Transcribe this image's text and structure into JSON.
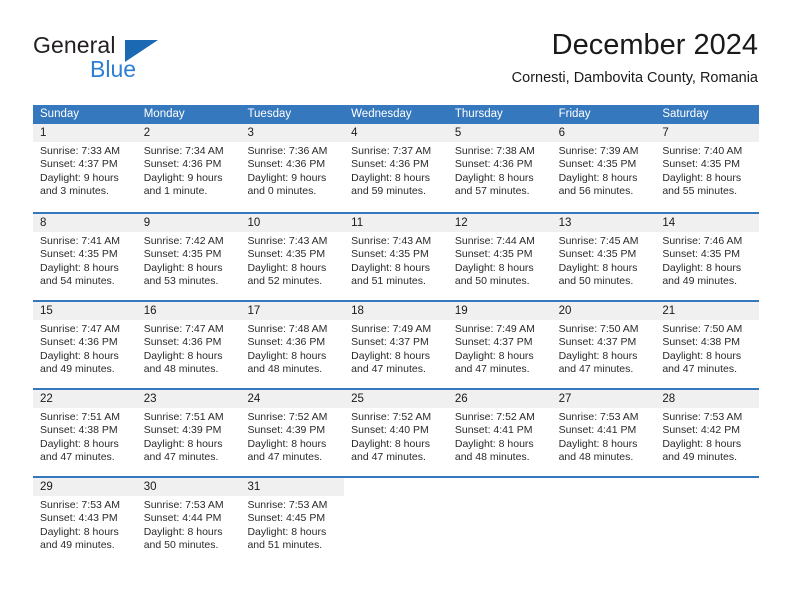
{
  "brand": {
    "name_part1": "General",
    "name_part2": "Blue",
    "triangle_color": "#1b69b3",
    "blue_color": "#2b7fd4"
  },
  "header": {
    "title": "December 2024",
    "subtitle": "Cornesti, Dambovita County, Romania"
  },
  "theme": {
    "header_blue": "#3678bd",
    "daynum_gray": "#f0f0f0",
    "text_color": "#1a1a1a"
  },
  "weekdays": [
    "Sunday",
    "Monday",
    "Tuesday",
    "Wednesday",
    "Thursday",
    "Friday",
    "Saturday"
  ],
  "weeks": [
    [
      {
        "day": "1",
        "sunrise": "Sunrise: 7:33 AM",
        "sunset": "Sunset: 4:37 PM",
        "daylight_l1": "Daylight: 9 hours",
        "daylight_l2": "and 3 minutes."
      },
      {
        "day": "2",
        "sunrise": "Sunrise: 7:34 AM",
        "sunset": "Sunset: 4:36 PM",
        "daylight_l1": "Daylight: 9 hours",
        "daylight_l2": "and 1 minute."
      },
      {
        "day": "3",
        "sunrise": "Sunrise: 7:36 AM",
        "sunset": "Sunset: 4:36 PM",
        "daylight_l1": "Daylight: 9 hours",
        "daylight_l2": "and 0 minutes."
      },
      {
        "day": "4",
        "sunrise": "Sunrise: 7:37 AM",
        "sunset": "Sunset: 4:36 PM",
        "daylight_l1": "Daylight: 8 hours",
        "daylight_l2": "and 59 minutes."
      },
      {
        "day": "5",
        "sunrise": "Sunrise: 7:38 AM",
        "sunset": "Sunset: 4:36 PM",
        "daylight_l1": "Daylight: 8 hours",
        "daylight_l2": "and 57 minutes."
      },
      {
        "day": "6",
        "sunrise": "Sunrise: 7:39 AM",
        "sunset": "Sunset: 4:35 PM",
        "daylight_l1": "Daylight: 8 hours",
        "daylight_l2": "and 56 minutes."
      },
      {
        "day": "7",
        "sunrise": "Sunrise: 7:40 AM",
        "sunset": "Sunset: 4:35 PM",
        "daylight_l1": "Daylight: 8 hours",
        "daylight_l2": "and 55 minutes."
      }
    ],
    [
      {
        "day": "8",
        "sunrise": "Sunrise: 7:41 AM",
        "sunset": "Sunset: 4:35 PM",
        "daylight_l1": "Daylight: 8 hours",
        "daylight_l2": "and 54 minutes."
      },
      {
        "day": "9",
        "sunrise": "Sunrise: 7:42 AM",
        "sunset": "Sunset: 4:35 PM",
        "daylight_l1": "Daylight: 8 hours",
        "daylight_l2": "and 53 minutes."
      },
      {
        "day": "10",
        "sunrise": "Sunrise: 7:43 AM",
        "sunset": "Sunset: 4:35 PM",
        "daylight_l1": "Daylight: 8 hours",
        "daylight_l2": "and 52 minutes."
      },
      {
        "day": "11",
        "sunrise": "Sunrise: 7:43 AM",
        "sunset": "Sunset: 4:35 PM",
        "daylight_l1": "Daylight: 8 hours",
        "daylight_l2": "and 51 minutes."
      },
      {
        "day": "12",
        "sunrise": "Sunrise: 7:44 AM",
        "sunset": "Sunset: 4:35 PM",
        "daylight_l1": "Daylight: 8 hours",
        "daylight_l2": "and 50 minutes."
      },
      {
        "day": "13",
        "sunrise": "Sunrise: 7:45 AM",
        "sunset": "Sunset: 4:35 PM",
        "daylight_l1": "Daylight: 8 hours",
        "daylight_l2": "and 50 minutes."
      },
      {
        "day": "14",
        "sunrise": "Sunrise: 7:46 AM",
        "sunset": "Sunset: 4:35 PM",
        "daylight_l1": "Daylight: 8 hours",
        "daylight_l2": "and 49 minutes."
      }
    ],
    [
      {
        "day": "15",
        "sunrise": "Sunrise: 7:47 AM",
        "sunset": "Sunset: 4:36 PM",
        "daylight_l1": "Daylight: 8 hours",
        "daylight_l2": "and 49 minutes."
      },
      {
        "day": "16",
        "sunrise": "Sunrise: 7:47 AM",
        "sunset": "Sunset: 4:36 PM",
        "daylight_l1": "Daylight: 8 hours",
        "daylight_l2": "and 48 minutes."
      },
      {
        "day": "17",
        "sunrise": "Sunrise: 7:48 AM",
        "sunset": "Sunset: 4:36 PM",
        "daylight_l1": "Daylight: 8 hours",
        "daylight_l2": "and 48 minutes."
      },
      {
        "day": "18",
        "sunrise": "Sunrise: 7:49 AM",
        "sunset": "Sunset: 4:37 PM",
        "daylight_l1": "Daylight: 8 hours",
        "daylight_l2": "and 47 minutes."
      },
      {
        "day": "19",
        "sunrise": "Sunrise: 7:49 AM",
        "sunset": "Sunset: 4:37 PM",
        "daylight_l1": "Daylight: 8 hours",
        "daylight_l2": "and 47 minutes."
      },
      {
        "day": "20",
        "sunrise": "Sunrise: 7:50 AM",
        "sunset": "Sunset: 4:37 PM",
        "daylight_l1": "Daylight: 8 hours",
        "daylight_l2": "and 47 minutes."
      },
      {
        "day": "21",
        "sunrise": "Sunrise: 7:50 AM",
        "sunset": "Sunset: 4:38 PM",
        "daylight_l1": "Daylight: 8 hours",
        "daylight_l2": "and 47 minutes."
      }
    ],
    [
      {
        "day": "22",
        "sunrise": "Sunrise: 7:51 AM",
        "sunset": "Sunset: 4:38 PM",
        "daylight_l1": "Daylight: 8 hours",
        "daylight_l2": "and 47 minutes."
      },
      {
        "day": "23",
        "sunrise": "Sunrise: 7:51 AM",
        "sunset": "Sunset: 4:39 PM",
        "daylight_l1": "Daylight: 8 hours",
        "daylight_l2": "and 47 minutes."
      },
      {
        "day": "24",
        "sunrise": "Sunrise: 7:52 AM",
        "sunset": "Sunset: 4:39 PM",
        "daylight_l1": "Daylight: 8 hours",
        "daylight_l2": "and 47 minutes."
      },
      {
        "day": "25",
        "sunrise": "Sunrise: 7:52 AM",
        "sunset": "Sunset: 4:40 PM",
        "daylight_l1": "Daylight: 8 hours",
        "daylight_l2": "and 47 minutes."
      },
      {
        "day": "26",
        "sunrise": "Sunrise: 7:52 AM",
        "sunset": "Sunset: 4:41 PM",
        "daylight_l1": "Daylight: 8 hours",
        "daylight_l2": "and 48 minutes."
      },
      {
        "day": "27",
        "sunrise": "Sunrise: 7:53 AM",
        "sunset": "Sunset: 4:41 PM",
        "daylight_l1": "Daylight: 8 hours",
        "daylight_l2": "and 48 minutes."
      },
      {
        "day": "28",
        "sunrise": "Sunrise: 7:53 AM",
        "sunset": "Sunset: 4:42 PM",
        "daylight_l1": "Daylight: 8 hours",
        "daylight_l2": "and 49 minutes."
      }
    ],
    [
      {
        "day": "29",
        "sunrise": "Sunrise: 7:53 AM",
        "sunset": "Sunset: 4:43 PM",
        "daylight_l1": "Daylight: 8 hours",
        "daylight_l2": "and 49 minutes."
      },
      {
        "day": "30",
        "sunrise": "Sunrise: 7:53 AM",
        "sunset": "Sunset: 4:44 PM",
        "daylight_l1": "Daylight: 8 hours",
        "daylight_l2": "and 50 minutes."
      },
      {
        "day": "31",
        "sunrise": "Sunrise: 7:53 AM",
        "sunset": "Sunset: 4:45 PM",
        "daylight_l1": "Daylight: 8 hours",
        "daylight_l2": "and 51 minutes."
      },
      {
        "day": "",
        "sunrise": "",
        "sunset": "",
        "daylight_l1": "",
        "daylight_l2": ""
      },
      {
        "day": "",
        "sunrise": "",
        "sunset": "",
        "daylight_l1": "",
        "daylight_l2": ""
      },
      {
        "day": "",
        "sunrise": "",
        "sunset": "",
        "daylight_l1": "",
        "daylight_l2": ""
      },
      {
        "day": "",
        "sunrise": "",
        "sunset": "",
        "daylight_l1": "",
        "daylight_l2": ""
      }
    ]
  ]
}
